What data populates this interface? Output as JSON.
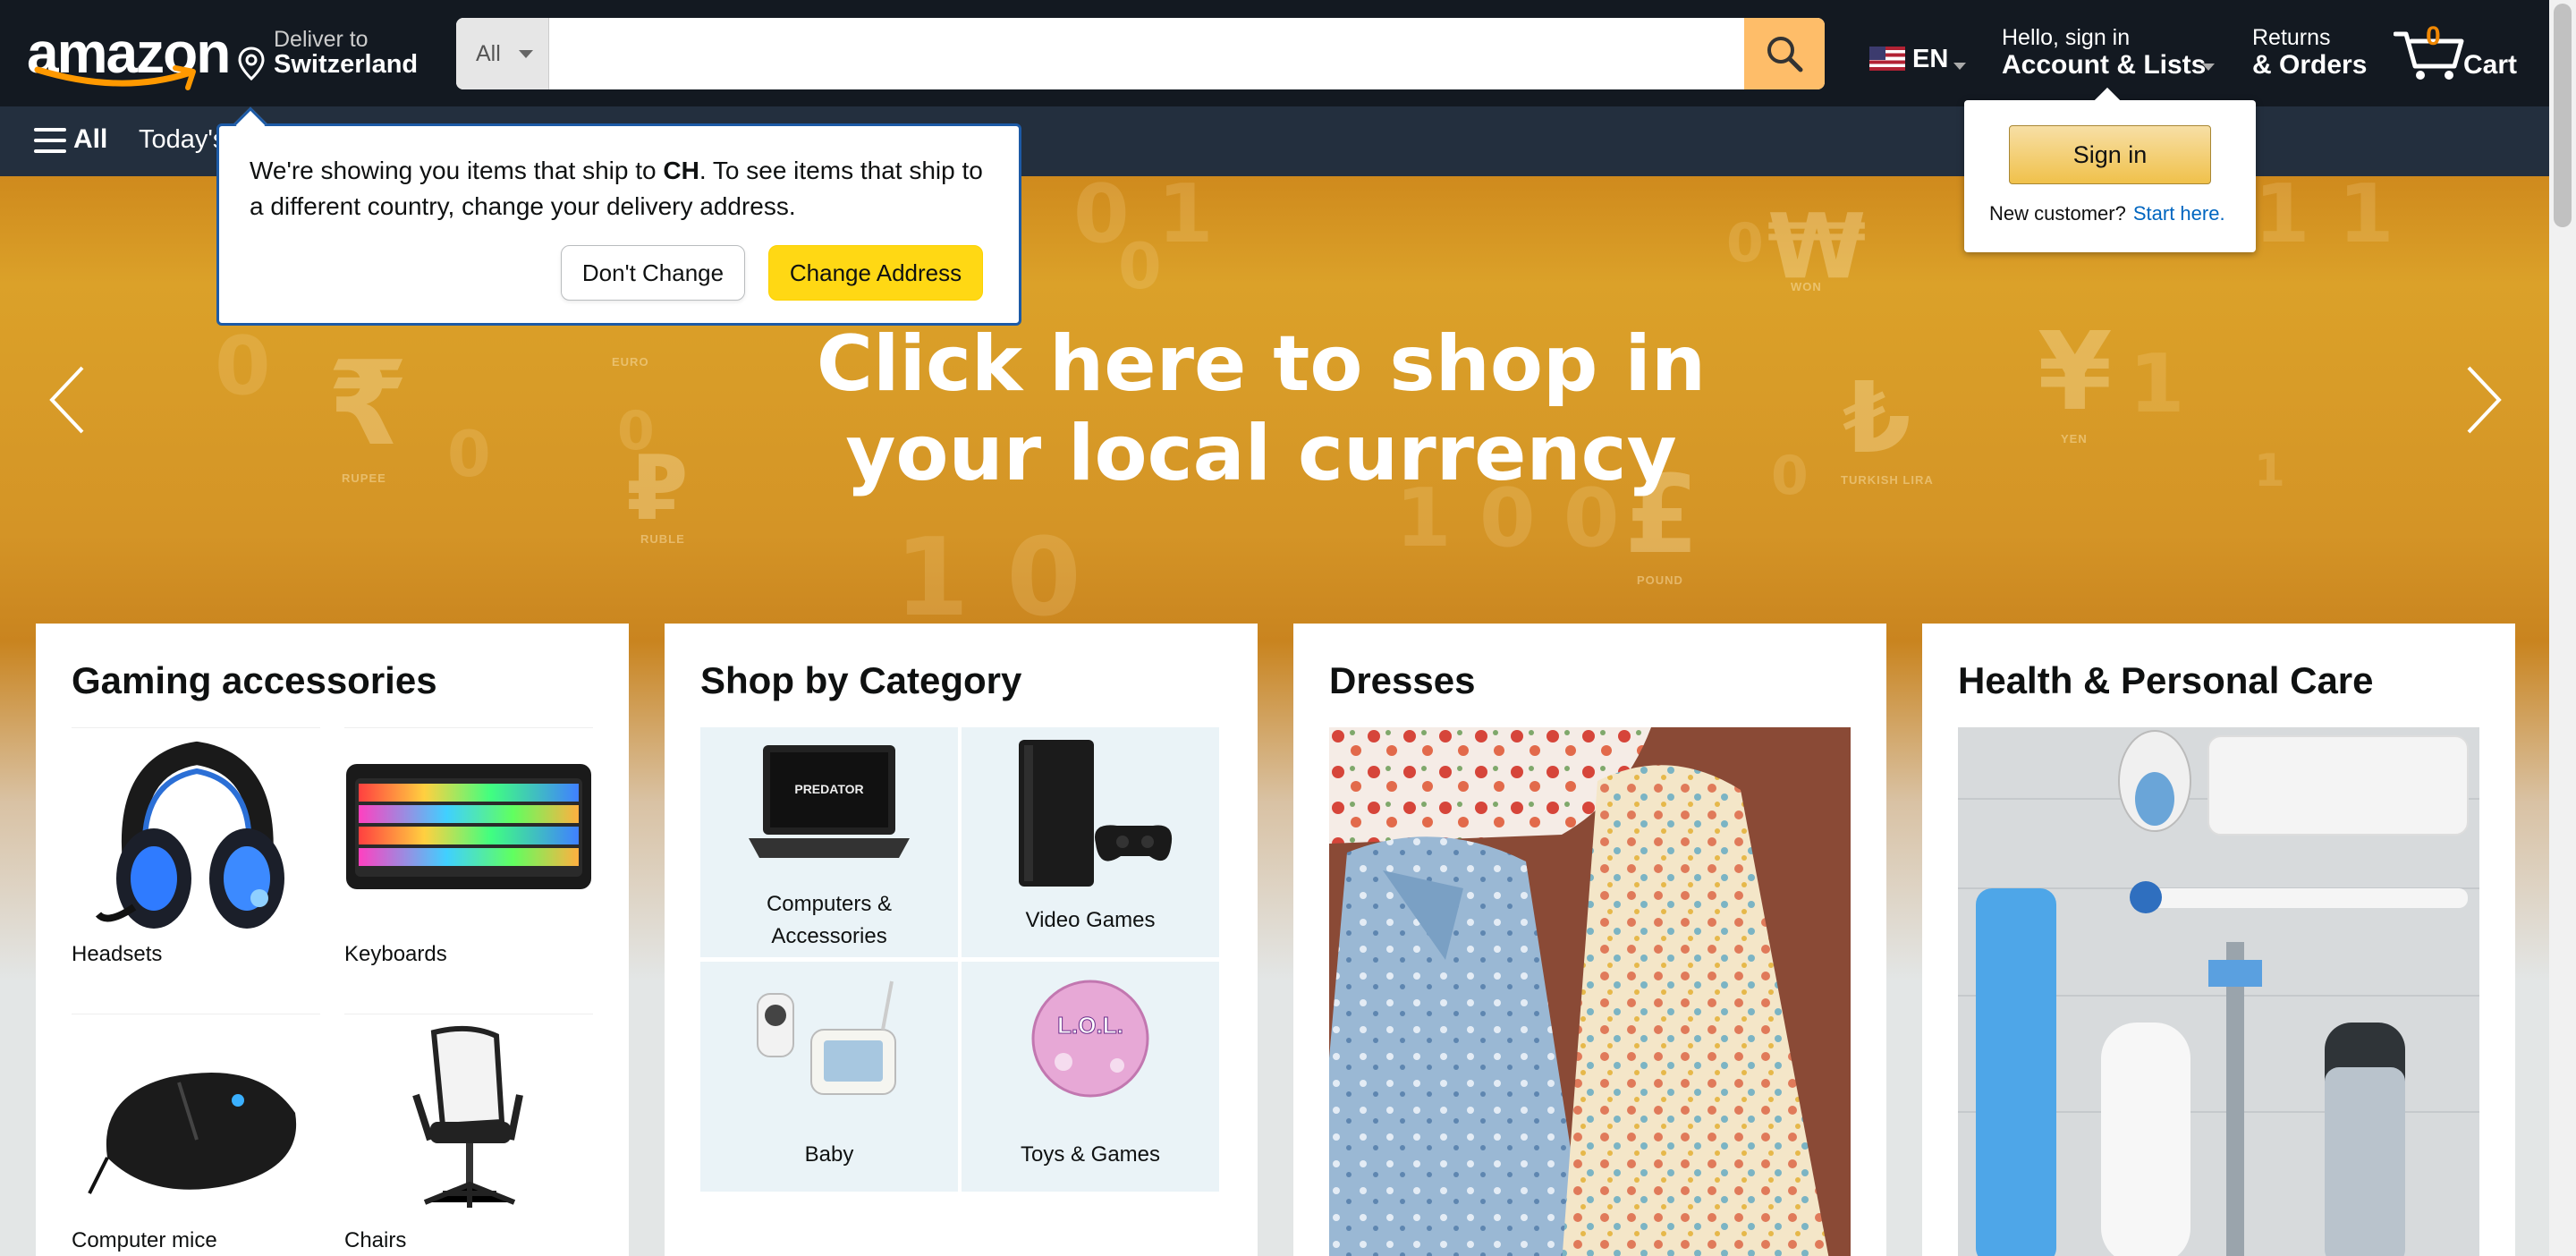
{
  "header": {
    "logo_text": "amazon",
    "deliver_label": "Deliver to",
    "deliver_country": "Switzerland",
    "search": {
      "category": "All",
      "placeholder": ""
    },
    "language": "EN",
    "account_greeting": "Hello, sign in",
    "account_label": "Account & Lists",
    "returns_label": "Returns",
    "orders_label": "& Orders",
    "cart_count": "0",
    "cart_label": "Cart"
  },
  "subnav": {
    "all_label": "All",
    "first_link": "Today's"
  },
  "ship_popover": {
    "text_before": "We're showing you items that ship to ",
    "country_code": "CH",
    "text_after": ". To see items that ship to a different country, change your delivery address.",
    "dont_change": "Don't Change",
    "change_address": "Change Address"
  },
  "signin_flyout": {
    "button": "Sign in",
    "new_customer": "New customer?",
    "start_here": "Start here."
  },
  "hero": {
    "line1": "Click here to shop in",
    "line2": "your local currency",
    "currencies": [
      {
        "symbol": "₹",
        "caption": "RUPEE"
      },
      {
        "symbol": "€",
        "caption": "EURO"
      },
      {
        "symbol": "₽",
        "caption": "RUBLE"
      },
      {
        "symbol": "₩",
        "caption": "WON"
      },
      {
        "symbol": "₺",
        "caption": "TURKISH LIRA"
      },
      {
        "symbol": "¥",
        "caption": "YEN"
      },
      {
        "symbol": "£",
        "caption": "POUND"
      }
    ]
  },
  "cards": [
    {
      "title": "Gaming accessories",
      "items": [
        "Headsets",
        "Keyboards",
        "Computer mice",
        "Chairs"
      ]
    },
    {
      "title": "Shop by Category",
      "items": [
        {
          "line1": "Computers &",
          "line2": "Accessories"
        },
        {
          "line1": "Video Games"
        },
        {
          "line1": "Baby"
        },
        {
          "line1": "Toys & Games"
        }
      ],
      "product_marks": {
        "laptop_brand": "PREDATOR",
        "toy_brand": "L.O.L."
      }
    },
    {
      "title": "Dresses"
    },
    {
      "title": "Health & Personal Care"
    }
  ],
  "colors": {
    "nav_dark": "#131921",
    "nav_light": "#232f3e",
    "search_button": "#febd69",
    "accent_yellow": "#ffd814",
    "cart_orange": "#f08804",
    "link_blue": "#0066c0"
  }
}
